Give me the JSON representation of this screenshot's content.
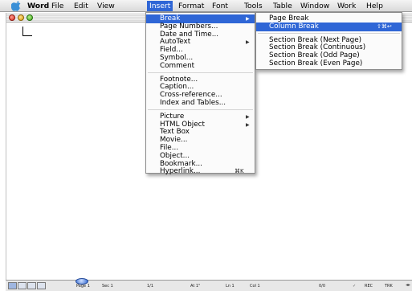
{
  "menubar": {
    "items": [
      "Word",
      "File",
      "Edit",
      "View",
      "Insert",
      "Format",
      "Font",
      "Tools",
      "Table",
      "Window",
      "Work",
      "Help"
    ],
    "active": "Insert"
  },
  "insert_menu": {
    "groups": [
      [
        {
          "label": "Break",
          "submenu": true,
          "highlighted": true
        },
        {
          "label": "Page Numbers...",
          "submenu": false
        },
        {
          "label": "Date and Time...",
          "submenu": false
        },
        {
          "label": "AutoText",
          "submenu": true
        },
        {
          "label": "Field...",
          "submenu": false
        },
        {
          "label": "Symbol...",
          "submenu": false
        },
        {
          "label": "Comment",
          "submenu": false
        }
      ],
      [
        {
          "label": "Footnote...",
          "submenu": false
        },
        {
          "label": "Caption...",
          "submenu": false
        },
        {
          "label": "Cross-reference...",
          "submenu": false
        },
        {
          "label": "Index and Tables...",
          "submenu": false
        }
      ],
      [
        {
          "label": "Picture",
          "submenu": true
        },
        {
          "label": "HTML Object",
          "submenu": true
        },
        {
          "label": "Text Box",
          "submenu": false
        },
        {
          "label": "Movie...",
          "submenu": false
        },
        {
          "label": "File...",
          "submenu": false
        },
        {
          "label": "Object...",
          "submenu": false
        },
        {
          "label": "Bookmark...",
          "submenu": false
        },
        {
          "label": "Hyperlink...",
          "submenu": false,
          "shortcut": "⌘K"
        }
      ]
    ]
  },
  "break_submenu": {
    "items": [
      {
        "label": "Page Break"
      },
      {
        "label": "Column Break",
        "shortcut": "⇧⌘↩",
        "highlighted": true
      },
      {
        "label": "Section Break (Next Page)"
      },
      {
        "label": "Section Break (Continuous)"
      },
      {
        "label": "Section Break (Odd Page)"
      },
      {
        "label": "Section Break (Even Page)"
      }
    ]
  },
  "statusbar": {
    "page": "Page 1",
    "sec": "Sec 1",
    "of": "1/1",
    "at": "At 1\"",
    "ln": "Ln 1",
    "col": "Col 1",
    "words": "0/0",
    "rec": "REC",
    "trk": "TRK"
  },
  "colors": {
    "highlight": "#2f66d6",
    "menubar": "#e6e6e6"
  }
}
